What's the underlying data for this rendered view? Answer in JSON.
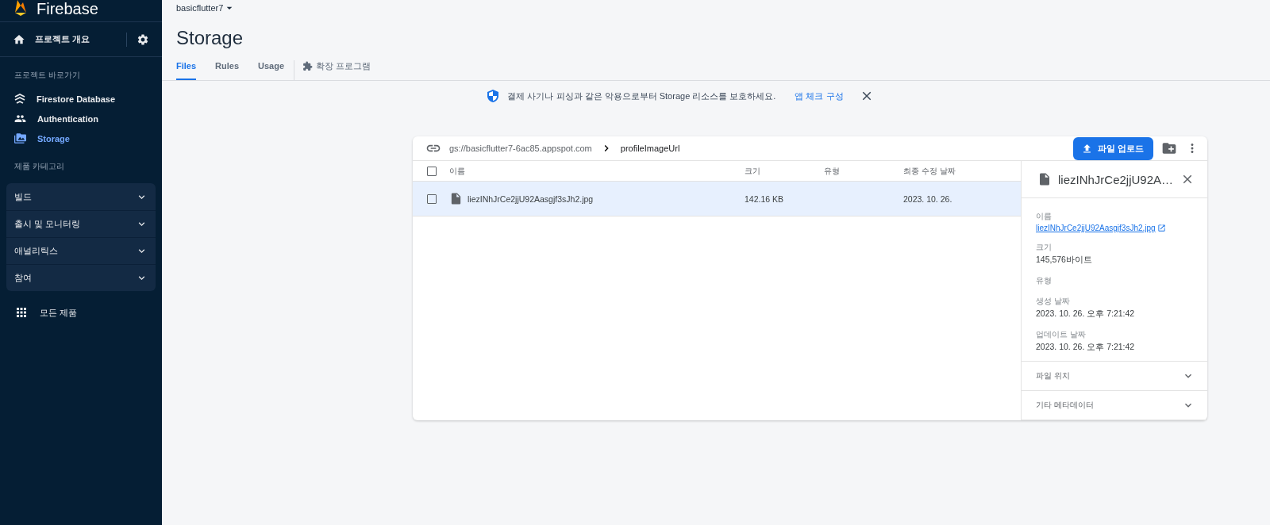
{
  "sidebar": {
    "brand": "Firebase",
    "overview": "프로젝트 개요",
    "shortcuts_heading": "프로젝트 바로가기",
    "shortcuts": [
      {
        "label": "Firestore Database",
        "selected": false
      },
      {
        "label": "Authentication",
        "selected": false
      },
      {
        "label": "Storage",
        "selected": true
      }
    ],
    "categories_heading": "제품 카테고리",
    "categories": [
      {
        "label": "빌드",
        "expanded": false
      },
      {
        "label": "출시 및 모니터링",
        "expanded": false
      },
      {
        "label": "애널리틱스",
        "expanded": false
      },
      {
        "label": "참여",
        "expanded": false
      }
    ],
    "all_products": "모든 제품"
  },
  "header": {
    "project": "basicflutter7",
    "title": "Storage",
    "tabs": [
      {
        "label": "Files",
        "selected": true
      },
      {
        "label": "Rules",
        "selected": false
      },
      {
        "label": "Usage",
        "selected": false
      }
    ],
    "extensions_tab": "확장 프로그램"
  },
  "banner": {
    "message": "결제 사기나 피싱과 같은 악용으로부터 Storage 리소스를 보호하세요.",
    "link": "앱 체크 구성"
  },
  "browser": {
    "bucket": "gs://basicflutter7-6ac85.appspot.com",
    "folder": "profileImageUrl",
    "upload_button": "파일 업로드",
    "all_checked": false,
    "columns": [
      "이름",
      "크기",
      "유형",
      "최종 수정 날짜"
    ],
    "rows": [
      {
        "name": "liezINhJrCe2jjU92Aasgjf3sJh2.jpg",
        "size": "142.16 KB",
        "modified": "2023. 10. 26.",
        "selected": true,
        "checked": false
      }
    ]
  },
  "details": {
    "title": "liezINhJrCe2jjU92A…",
    "fields": [
      {
        "label": "이름",
        "value": "liezINhJrCe2jjU92Aasgjf3sJh2.jpg",
        "kind": "link"
      },
      {
        "label": "크기",
        "value": "145,576바이트",
        "kind": "text"
      },
      {
        "label": "유형"
      },
      {
        "label": "생성 날짜",
        "value": "2023. 10. 26. 오후 7:21:42",
        "kind": "text"
      },
      {
        "label": "업데이트 날짜",
        "value": "2023. 10. 26. 오후 7:21:42",
        "kind": "text"
      }
    ],
    "sections": [
      {
        "label": "파일 위치",
        "expanded": false
      },
      {
        "label": "기타 메타데이터",
        "expanded": false
      }
    ]
  }
}
